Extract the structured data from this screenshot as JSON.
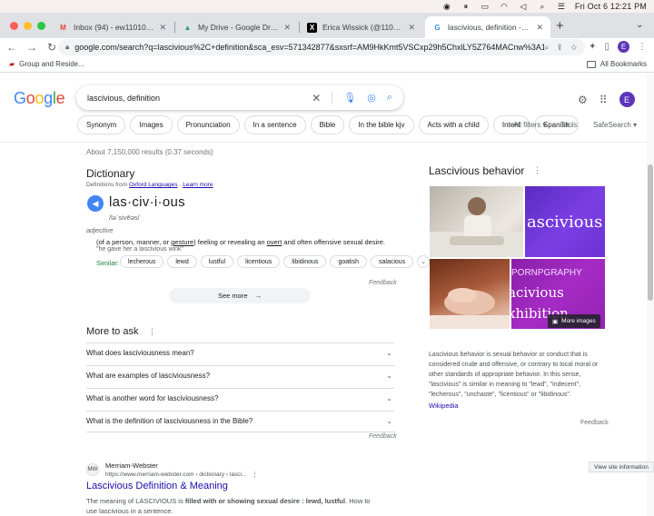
{
  "menubar": {
    "clock": "Fri Oct 6  12:21 PM"
  },
  "tabs": [
    {
      "title": "Inbox (94) - ew11010@gmail.c",
      "icon": "gmail-icon",
      "favicon_glyph": "M"
    },
    {
      "title": "My Drive - Google Drive",
      "icon": "drive-icon",
      "favicon_glyph": "▲"
    },
    {
      "title": "Erica Wissick (@11010erieri) /",
      "icon": "x-icon",
      "favicon_glyph": "X"
    },
    {
      "title": "lascivious, definition - Google",
      "icon": "google-icon",
      "favicon_glyph": "G"
    }
  ],
  "toolbar": {
    "url": "google.com/search?q=lascivious%2C+definition&sca_esv=571342877&sxsrf=AM9HkKmt5VSCxp29h5ChxlLY5Z764MACnw%3A1...",
    "profile_letter": "E"
  },
  "bookmarks": {
    "item": "Group and Reside...",
    "all": "All Bookmarks"
  },
  "search": {
    "query": "lascivious, definition",
    "avatar_letter": "E"
  },
  "chips": [
    "Synonym",
    "Images",
    "Pronunciation",
    "In a sentence",
    "Bible",
    "In the bible kjv",
    "Acts with a child",
    "Intent",
    "Spanish"
  ],
  "filters": {
    "all_filters": "All filters",
    "tools": "Tools",
    "safesearch": "SafeSearch"
  },
  "stats": "About 7,150,000 results (0.37 seconds)",
  "dictionary": {
    "title": "Dictionary",
    "source_prefix": "Definitions from",
    "source_link": "Oxford Languages",
    "learn_more": "Learn more",
    "word": "las·civ·i·ous",
    "phonetic": "/ləˈsivēəs/",
    "part_of_speech": "adjective",
    "definition_a": "(of a person, manner, or ",
    "definition_b": "gesture",
    "definition_c": ") feeling or revealing an ",
    "definition_d": "overt",
    "definition_e": " and often offensive sexual desire.",
    "example": "\"he gave her a lascivious wink\"",
    "similar_label": "Similar:",
    "similar": [
      "lecherous",
      "lewd",
      "lustful",
      "licentious",
      "libidinous",
      "goatish",
      "salacious"
    ],
    "feedback": "Feedback",
    "see_more": "See more"
  },
  "people_also_ask": {
    "title": "More to ask",
    "questions": [
      "What does lasciviousness mean?",
      "What are examples of lasciviousness?",
      "What is another word for lasciviousness?",
      "What is the definition of lasciviousness in the Bible?"
    ],
    "feedback": "Feedback"
  },
  "result": {
    "site": "Merriam-Webster",
    "url": "https://www.merriam-webster.com › dictionary › lasci...",
    "title": "Lascivious Definition & Meaning",
    "snippet_a": "The meaning of LASCIVIOUS is ",
    "snippet_b": "filled with or showing sexual desire : lewd, lustful",
    "snippet_c": ". How to use lascivious in a sentence."
  },
  "knowledge_panel": {
    "title": "Lascivious behavior",
    "image2_text": "ascivious",
    "image4_text_1": "PORNPGRAPHY",
    "image4_text_2": "acivious",
    "image4_text_3": "xhibition",
    "more_images": "More images",
    "description": "Lascivious behavior is sexual behavior or conduct that is considered crude and offensive, or contrary to local moral or other standards of appropriate behavior. In this sense, \"lascivious\" is similar in meaning to \"lewd\", \"indecent\", \"lecherous\", \"unchaste\", \"licentious\" or \"libidinous\".",
    "wikipedia": "Wikipedia",
    "feedback": "Feedback"
  },
  "tooltip": "View site information"
}
